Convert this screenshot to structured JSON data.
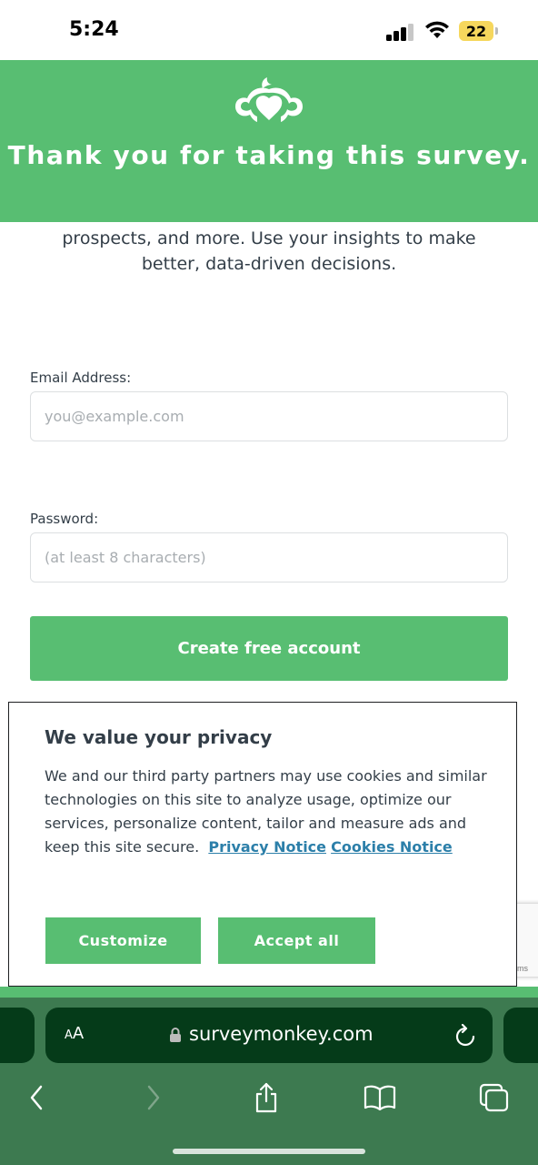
{
  "status_bar": {
    "time": "5:24",
    "battery": "22"
  },
  "banner": {
    "title": "Thank you for taking this survey.",
    "logo_icon": "surveymonkey-logo-icon"
  },
  "intro": {
    "text": "Gather opinions from customers, employees, prospects, and more. Use your insights to make better, data-driven decisions."
  },
  "form": {
    "email_label": "Email Address:",
    "email_placeholder": "you@example.com",
    "password_label": "Password:",
    "password_placeholder": "(at least 8 characters)",
    "submit_label": "Create free account"
  },
  "recaptcha": {
    "text": "ms"
  },
  "privacy": {
    "title": "We value your privacy",
    "body": "We and our third party partners may use cookies and similar technologies on this site to analyze usage, optimize our services, personalize content, tailor and measure ads and keep this site secure.",
    "privacy_link": "Privacy Notice",
    "cookies_link": "Cookies Notice",
    "customize_label": "Customize",
    "accept_label": "Accept all"
  },
  "browser": {
    "aa_label_small": "A",
    "aa_label_large": "A",
    "url": "surveymonkey.com"
  },
  "colors": {
    "brand_green": "#58be72",
    "toolbar_green": "#3d7a50",
    "address_bar": "#053b19",
    "link_blue": "#2c7fa9",
    "text_dark": "#333e48"
  }
}
